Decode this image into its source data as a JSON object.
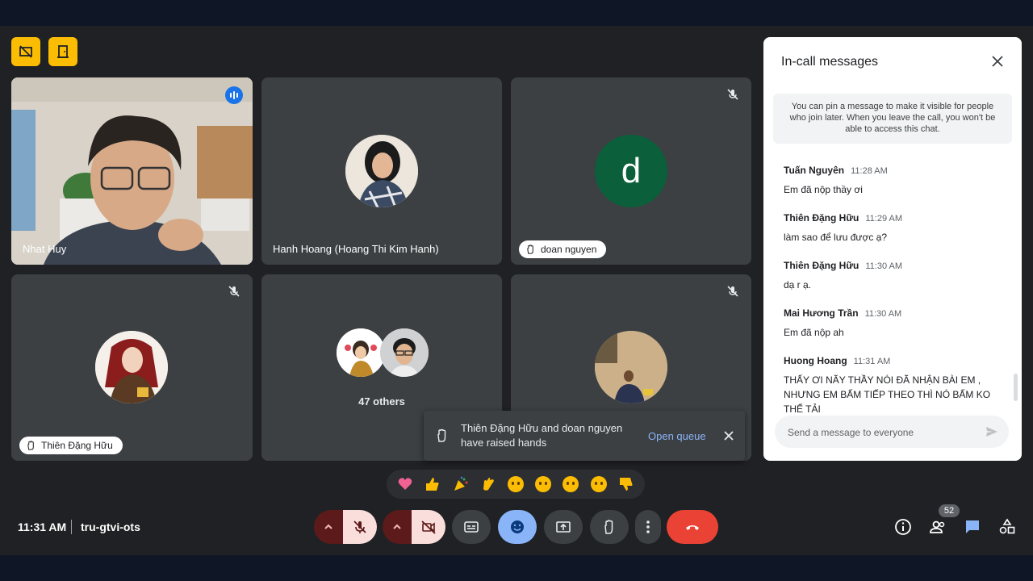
{
  "meeting": {
    "time": "11:31 AM",
    "code": "tru-gtvi-ots"
  },
  "tiles": {
    "t1": {
      "name": "Nhat Huy"
    },
    "t2": {
      "name": "Hanh Hoang (Hoang Thi Kim Hanh)"
    },
    "t3": {
      "name": "doan nguyen",
      "initial": "d"
    },
    "t4": {
      "name": "Thiên Đặng Hữu"
    },
    "t5": {
      "label": "47 others"
    }
  },
  "toast": {
    "text": "Thiên Đặng Hữu and doan nguyen have raised hands",
    "action": "Open queue"
  },
  "emojis": [
    "sparkling-heart",
    "thumbs-up",
    "party-popper",
    "clapping-hands",
    "tears-of-joy",
    "surprised",
    "sad",
    "thinking",
    "thumbs-down"
  ],
  "controls": {
    "mic": "mic-off-icon",
    "camera": "camera-off-icon",
    "captions": "captions-icon",
    "emoji": "emoji-icon",
    "present": "present-icon",
    "raise_hand": "raise-hand-icon",
    "more": "more-icon",
    "leave": "leave-call-icon"
  },
  "right_controls": {
    "people_count": "52"
  },
  "chat": {
    "title": "In-call messages",
    "info": "You can pin a message to make it visible for people who join later. When you leave the call, you won't be able to access this chat.",
    "placeholder": "Send a message to everyone",
    "messages": [
      {
        "sender": "Tuấn Nguyên",
        "time": "11:28 AM",
        "text": "Em đã nộp thầy ơi"
      },
      {
        "sender": "Thiên Đặng Hữu",
        "time": "11:29 AM",
        "text": "làm sao để lưu được ạ?"
      },
      {
        "sender": "Thiên Đặng Hữu",
        "time": "11:30 AM",
        "text": "dạ r ạ."
      },
      {
        "sender": "Mai Hương Trần",
        "time": "11:30 AM",
        "text": "Em đã nộp ah"
      },
      {
        "sender": "Huong Hoang",
        "time": "11:31 AM",
        "text": "THẤY ƠI NÃY THẦY NÓI ĐÃ NHẬN BÀI EM , NHƯNG EM BẤM TIẾP THEO THÌ NÓ BẤM KO THỂ TẢI"
      }
    ]
  },
  "colors": {
    "accent": "#8ab4f8",
    "leave": "#ea4335",
    "tile": "#3c4043",
    "avatar_d": "#0b5f3a",
    "host_button": "#fbbc04"
  }
}
